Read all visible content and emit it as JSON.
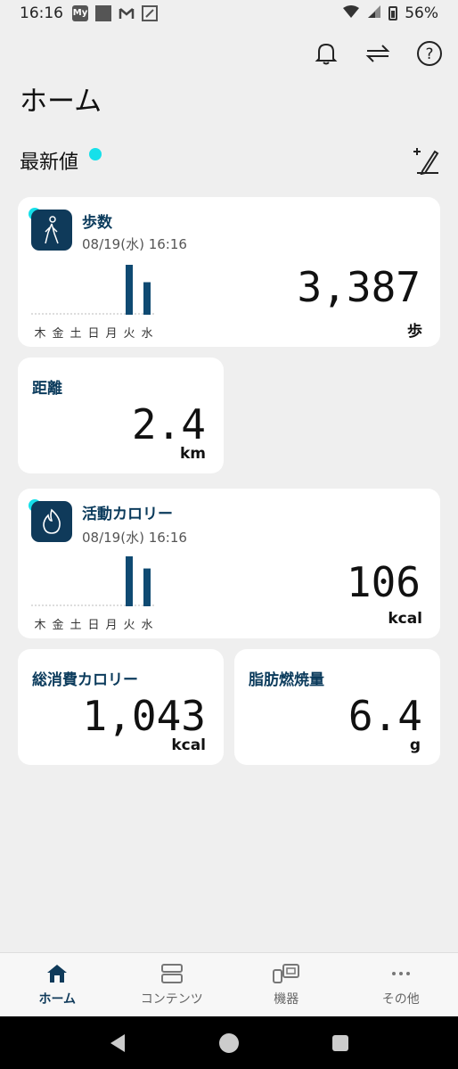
{
  "status_bar": {
    "time": "16:16",
    "my_icon_label": "My",
    "battery": "56%"
  },
  "header": {
    "title": "ホーム"
  },
  "section": {
    "title": "最新値"
  },
  "cards": {
    "steps": {
      "title": "歩数",
      "date": "08/19(水) 16:16",
      "value": "3,387",
      "unit": "歩",
      "days": [
        "木",
        "金",
        "土",
        "日",
        "月",
        "火",
        "水"
      ],
      "chart_bars": [
        0,
        0,
        0,
        0,
        0,
        3300,
        2150
      ]
    },
    "distance": {
      "title": "距離",
      "value": "2.4",
      "unit": "km"
    },
    "active_calories": {
      "title": "活動カロリー",
      "date": "08/19(水) 16:16",
      "value": "106",
      "unit": "kcal",
      "days": [
        "木",
        "金",
        "土",
        "日",
        "月",
        "火",
        "水"
      ],
      "chart_bars": [
        0,
        0,
        0,
        0,
        0,
        140,
        106
      ]
    },
    "total_calories": {
      "title": "総消費カロリー",
      "value": "1,043",
      "unit": "kcal"
    },
    "fat_burn": {
      "title": "脂肪燃焼量",
      "value": "6.4",
      "unit": "g"
    }
  },
  "bottom_nav": {
    "items": [
      {
        "label": "ホーム",
        "icon": "home-icon",
        "active": true
      },
      {
        "label": "コンテンツ",
        "icon": "contents-icon",
        "active": false
      },
      {
        "label": "機器",
        "icon": "devices-icon",
        "active": false
      },
      {
        "label": "その他",
        "icon": "more-icon",
        "active": false
      }
    ]
  },
  "colors": {
    "accent": "#0f3a5a",
    "dot": "#16e0ea",
    "background": "#efefef"
  }
}
